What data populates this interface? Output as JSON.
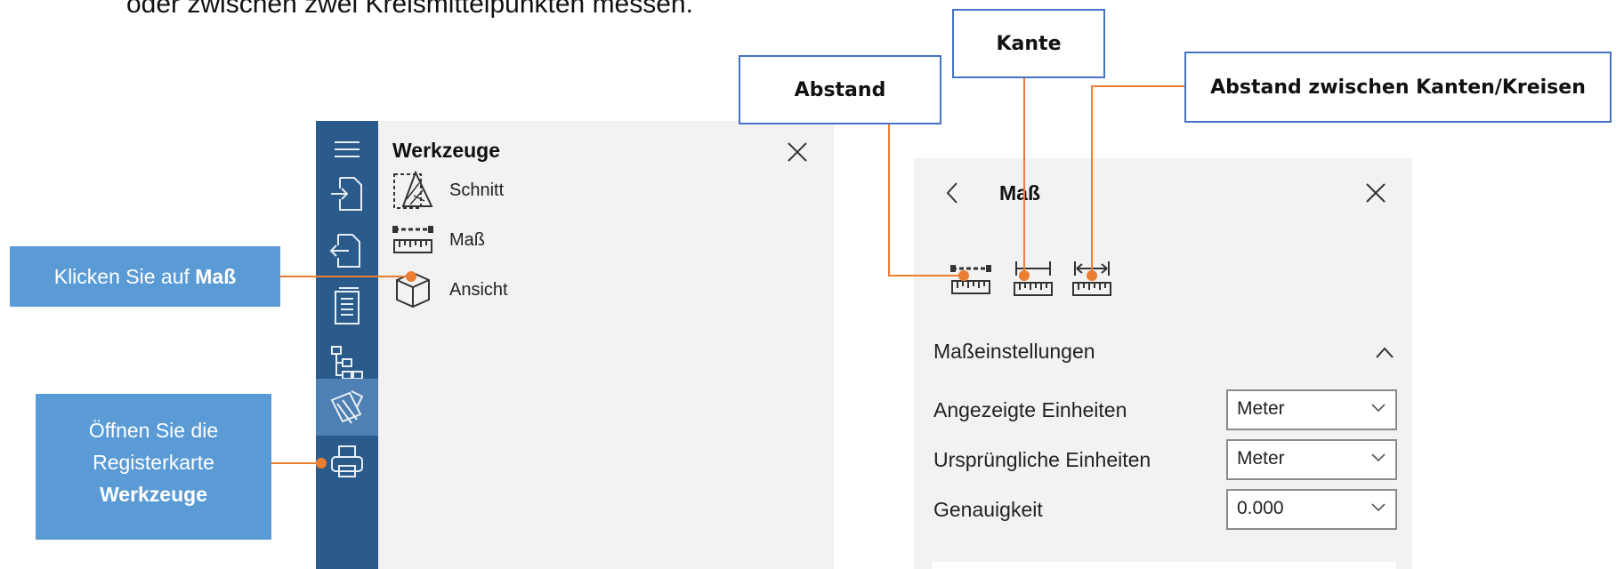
{
  "intro_text": "oder zwischen zwei Kreismittelpunkten messen.",
  "callouts": {
    "click_measure_prefix": "Klicken Sie auf ",
    "click_measure_bold": "Maß",
    "open_tab_line1": "Öffnen Sie die",
    "open_tab_line2": "Registerkarte",
    "open_tab_bold": "Werkzeuge",
    "distance": "Abstand",
    "edge": "Kante",
    "distance_between": "Abstand zwischen Kanten/Kreisen"
  },
  "sidebar": {
    "items": [
      {
        "icon": "menu-icon"
      },
      {
        "icon": "import-icon"
      },
      {
        "icon": "export-icon"
      },
      {
        "icon": "document-icon"
      },
      {
        "icon": "hierarchy-icon"
      },
      {
        "icon": "tools-icon",
        "active": true
      },
      {
        "icon": "print-icon"
      }
    ]
  },
  "tools_panel": {
    "title": "Werkzeuge",
    "items": [
      {
        "label": "Schnitt",
        "icon": "section-icon"
      },
      {
        "label": "Maß",
        "icon": "measure-ruler-icon"
      },
      {
        "label": "Ansicht",
        "icon": "cube-view-icon"
      }
    ]
  },
  "measure_panel": {
    "title": "Maß",
    "tools": [
      {
        "icon": "distance-ruler-icon"
      },
      {
        "icon": "edge-ruler-icon"
      },
      {
        "icon": "edge-distance-ruler-icon"
      }
    ],
    "settings_title": "Maßeinstellungen",
    "settings": [
      {
        "label": "Angezeigte Einheiten",
        "value": "Meter"
      },
      {
        "label": "Ursprüngliche Einheiten",
        "value": "Meter"
      },
      {
        "label": "Genauigkeit",
        "value": "0.000"
      }
    ]
  },
  "colors": {
    "rail": "#2b5b8a",
    "rail_active": "#4f80b3",
    "callout_blue": "#5b9bd5",
    "callout_border": "#4472c4",
    "connector": "#ed7d31"
  }
}
